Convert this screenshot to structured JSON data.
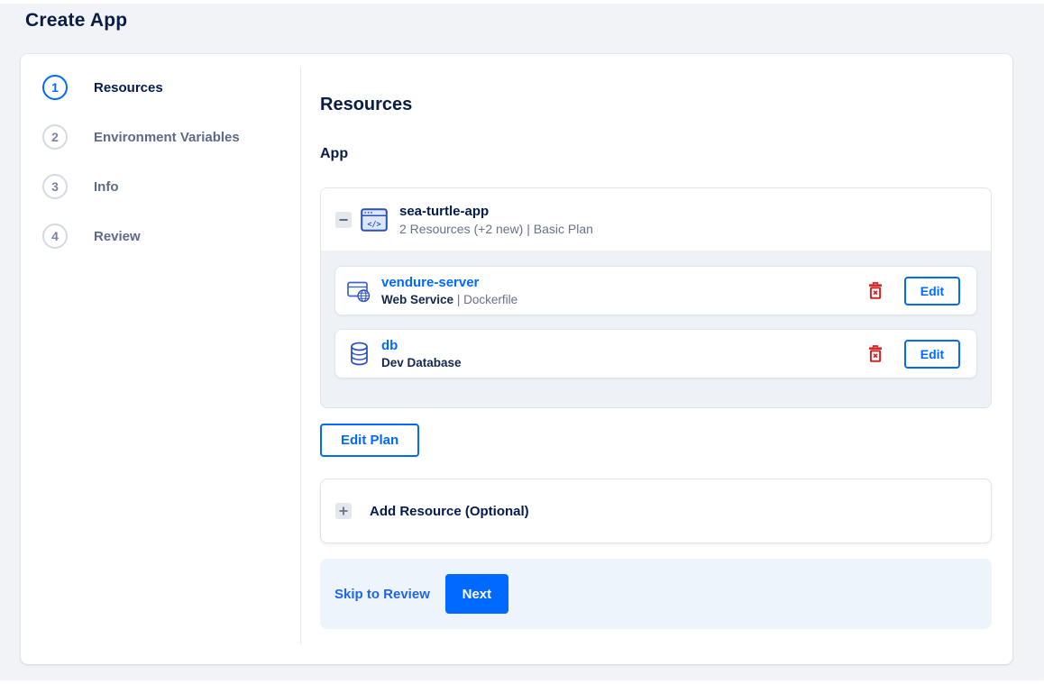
{
  "page": {
    "title": "Create App"
  },
  "stepper": {
    "steps": [
      {
        "number": "1",
        "label": "Resources",
        "active": true
      },
      {
        "number": "2",
        "label": "Environment Variables",
        "active": false
      },
      {
        "number": "3",
        "label": "Info",
        "active": false
      },
      {
        "number": "4",
        "label": "Review",
        "active": false
      }
    ]
  },
  "content": {
    "heading": "Resources",
    "section_label": "App",
    "app": {
      "name": "sea-turtle-app",
      "summary": "2 Resources (+2 new) | Basic Plan",
      "collapse_icon": "minus-icon",
      "app_icon": "code-window-icon",
      "resources": [
        {
          "name": "vendure-server",
          "type": "Web Service",
          "separator": "|",
          "detail": "Dockerfile",
          "icon": "browser-globe-icon",
          "delete_icon": "trash-icon",
          "edit_label": "Edit"
        },
        {
          "name": "db",
          "type": "Dev Database",
          "separator": "",
          "detail": "",
          "icon": "database-cylinder-icon",
          "delete_icon": "trash-icon",
          "edit_label": "Edit"
        }
      ]
    },
    "edit_plan_label": "Edit Plan",
    "add_resource": {
      "icon": "plus-icon",
      "label": "Add Resource (Optional)"
    },
    "footer": {
      "skip_label": "Skip to Review",
      "next_label": "Next"
    }
  },
  "colors": {
    "accent_blue": "#0069ff",
    "navy_text": "#031b4e",
    "muted_text": "#68718a",
    "danger_red": "#d32222",
    "icon_blue_stroke": "#2a4fba",
    "icon_blue_fill": "#dce8fa",
    "footer_bg": "#edf4fb",
    "page_bg": "#f1f3f7"
  }
}
